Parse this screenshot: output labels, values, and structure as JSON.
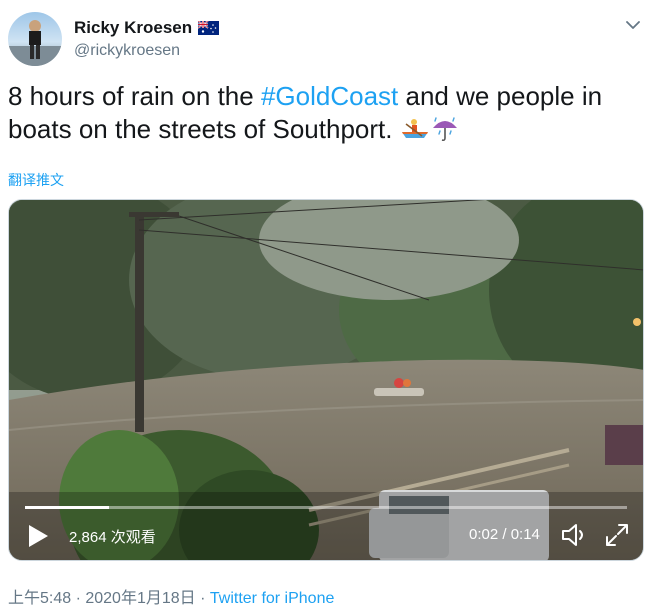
{
  "author": {
    "display_name": "Ricky Kroesen",
    "handle": "@rickykroesen",
    "flag_icon": "australian-flag-icon"
  },
  "tweet": {
    "text_part1": "8 hours of rain on the ",
    "hashtag": "#GoldCoast",
    "text_part2": " and we people in boats on the streets of Southport. ",
    "emojis": [
      "rowboat-icon",
      "umbrella-rain-icon"
    ],
    "translate_label": "翻译推文"
  },
  "video": {
    "views": "2,864 次观看",
    "time": "0:02 / 0:14",
    "progress_fraction": 0.14
  },
  "footer": {
    "timestamp": "上午5:48 · 2020年1月18日 · ",
    "source": "Twitter for iPhone"
  },
  "colors": {
    "link": "#1da1f2",
    "secondary_text": "#657786",
    "primary_text": "#14171a"
  }
}
